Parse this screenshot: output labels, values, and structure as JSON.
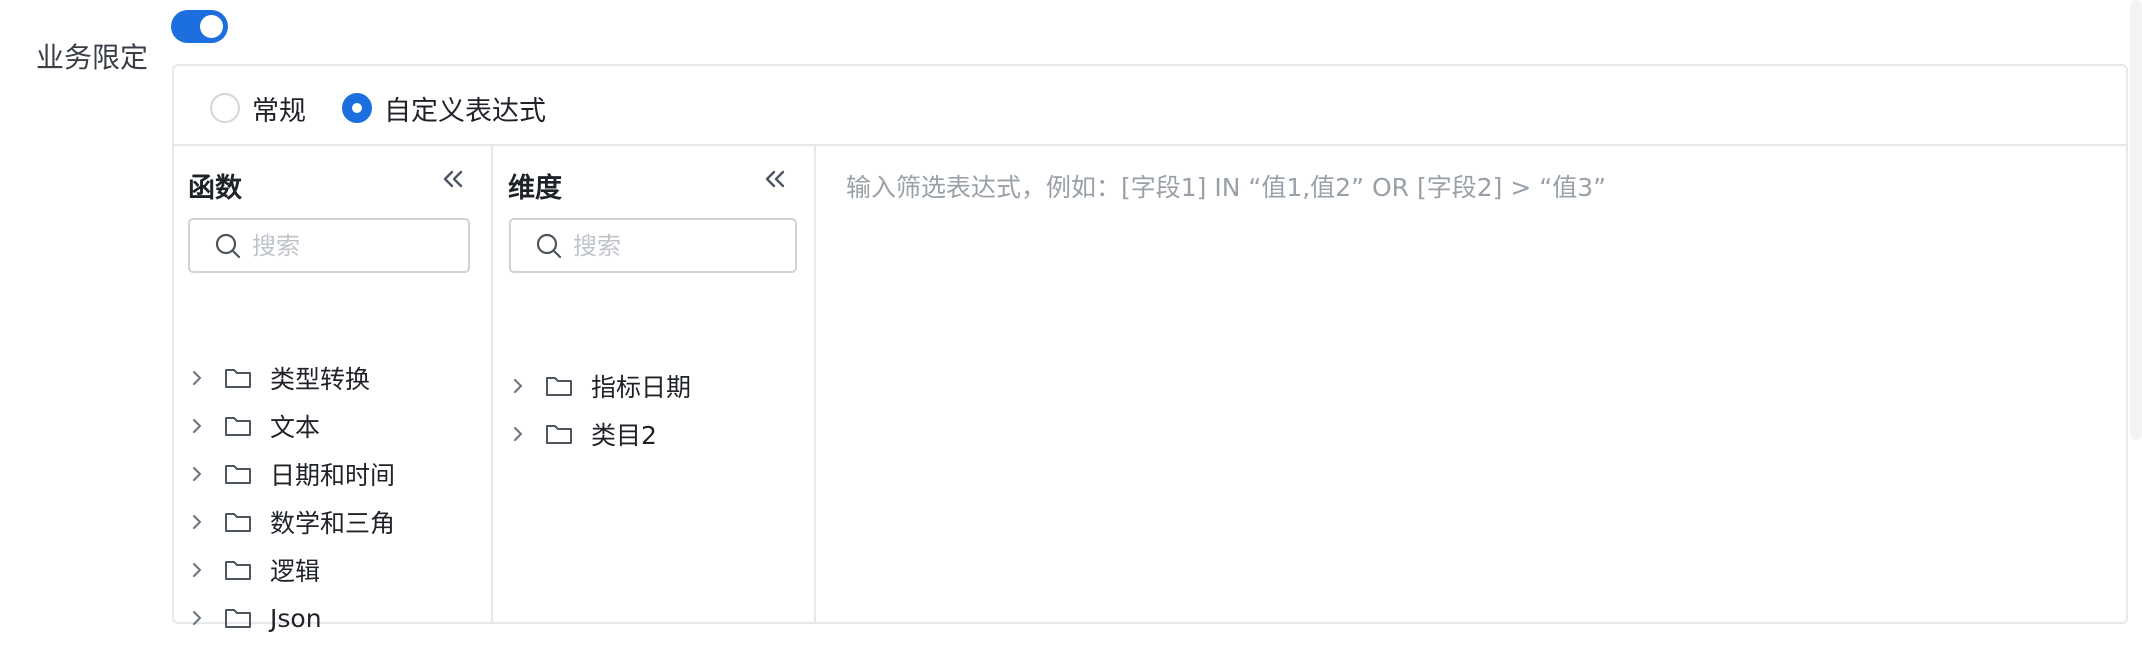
{
  "form": {
    "label": "业务限定",
    "enabled": true
  },
  "mode": {
    "options": [
      {
        "label": "常规",
        "checked": false
      },
      {
        "label": "自定义表达式",
        "checked": true
      }
    ]
  },
  "functions": {
    "title": "函数",
    "search_placeholder": "搜索",
    "items": [
      {
        "label": "类型转换"
      },
      {
        "label": "文本"
      },
      {
        "label": "日期和时间"
      },
      {
        "label": "数学和三角"
      },
      {
        "label": "逻辑"
      },
      {
        "label": "Json"
      }
    ]
  },
  "dimensions": {
    "title": "维度",
    "search_placeholder": "搜索",
    "items": [
      {
        "label": "指标日期"
      },
      {
        "label": "类目2"
      }
    ]
  },
  "editor": {
    "placeholder": "输入筛选表达式，例如：[字段1] IN “值1,值2” OR [字段2] > “值3”",
    "value": ""
  },
  "colors": {
    "accent": "#1d6fe0",
    "border": "#e6e8ec",
    "placeholder": "#9aa0a8"
  }
}
